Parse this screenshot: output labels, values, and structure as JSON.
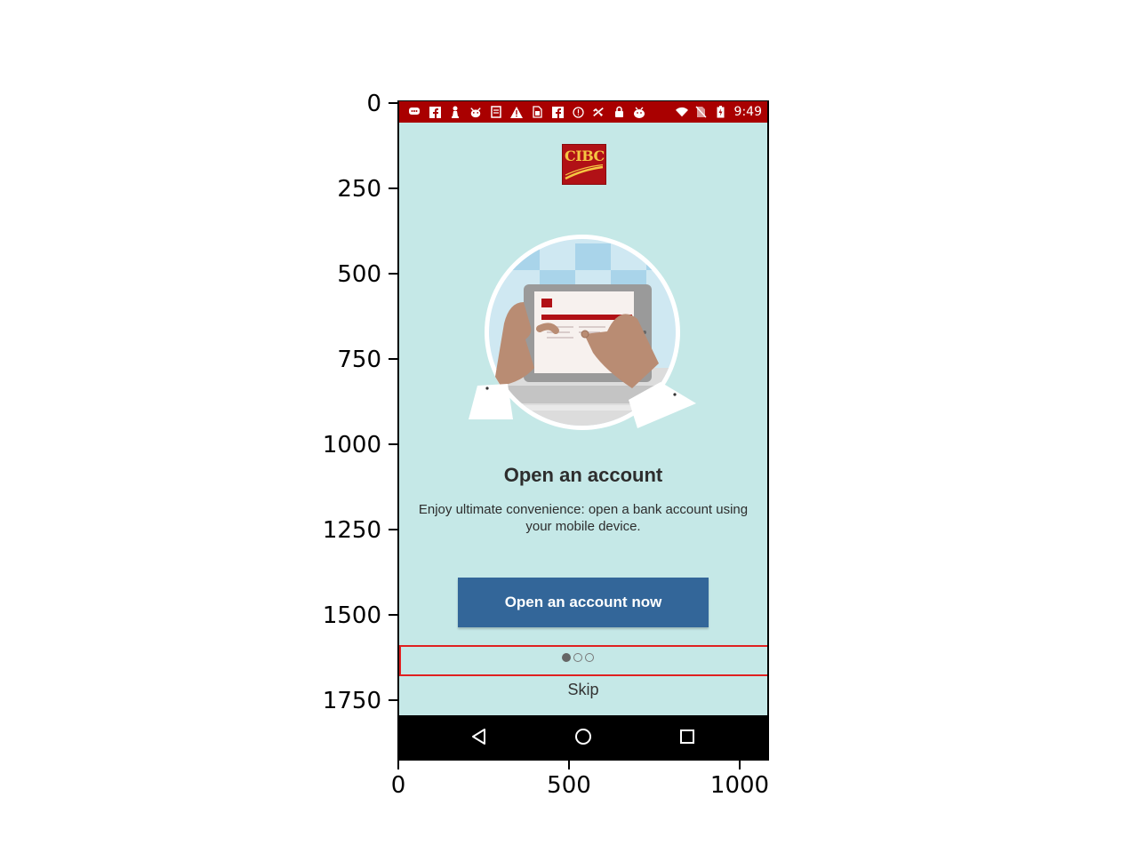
{
  "axes": {
    "y_ticks": [
      "0",
      "250",
      "500",
      "750",
      "1000",
      "1250",
      "1500",
      "1750"
    ],
    "x_ticks": [
      "0",
      "500",
      "1000"
    ]
  },
  "status_bar": {
    "time": "9:49",
    "background": "#a90000",
    "icons": [
      "chat-icon",
      "facebook-icon",
      "chess-icon",
      "android-face-icon",
      "memo-icon",
      "warning-icon",
      "sim-icon",
      "facebook-icon",
      "alert-circle-icon",
      "satellite-icon",
      "lock-icon",
      "android-icon",
      "wifi-icon",
      "no-sim-icon",
      "battery-icon"
    ]
  },
  "logo": {
    "text": "CIBC",
    "color": "#b11116"
  },
  "onboarding": {
    "title": "Open an account",
    "description": "Enjoy ultimate convenience: open a bank account using your mobile device.",
    "cta_label": "Open an account now",
    "skip_label": "Skip",
    "page_indicator": {
      "current": 1,
      "total": 3
    },
    "background": "#c5e8e7",
    "accent": "#336699"
  },
  "nav_bar": {
    "buttons": [
      "back-icon",
      "home-icon",
      "recents-icon"
    ]
  }
}
